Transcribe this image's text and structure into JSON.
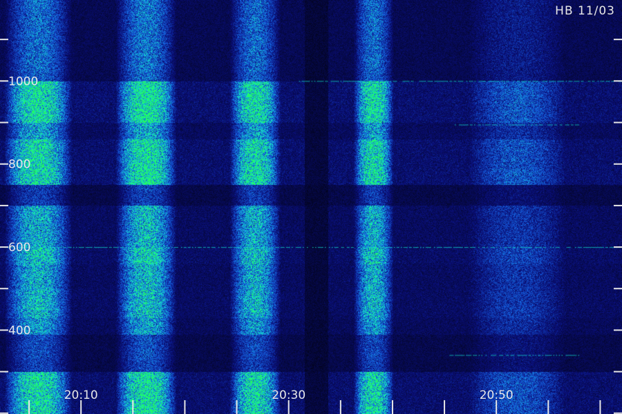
{
  "station_label": "HB 11/03",
  "colors": {
    "background": "#020319",
    "low": "#0a0f7a",
    "mid": "#1560e0",
    "high": "#13dccb",
    "peak": "#22ff5a",
    "labels": "#e8e8e8"
  },
  "chart_data": {
    "type": "heatmap",
    "title": "",
    "xlabel": "",
    "ylabel": "",
    "x_tick_labels": [
      "20:10",
      "20:30",
      "20:50"
    ],
    "x_tick_times_min": [
      10,
      30,
      50
    ],
    "x_range_min": [
      2.2,
      62.1
    ],
    "y_tick_labels": [
      "1000",
      "800",
      "600",
      "400"
    ],
    "y_tick_values": [
      1000,
      800,
      600,
      400
    ],
    "y_range": [
      198,
      1195
    ],
    "y_major_step": 100,
    "x_minor_step_min": 5,
    "echo_bursts": [
      {
        "start_min": 2.2,
        "end_min": 9.5,
        "intensity": 0.9
      },
      {
        "start_min": 13.0,
        "end_min": 19.5,
        "intensity": 0.95
      },
      {
        "start_min": 24.0,
        "end_min": 29.5,
        "intensity": 0.88
      },
      {
        "start_min": 36.0,
        "end_min": 40.3,
        "intensity": 0.9
      },
      {
        "start_min": 46.0,
        "end_min": 58.0,
        "intensity": 0.45
      }
    ],
    "quiet_gap_min": [
      31.5,
      33.8
    ],
    "frequency_bands": [
      {
        "low": 1000,
        "high": 1025,
        "gain": 0.25
      },
      {
        "low": 900,
        "high": 1000,
        "gain": 0.95
      },
      {
        "low": 860,
        "high": 900,
        "gain": 0.55
      },
      {
        "low": 790,
        "high": 860,
        "gain": 0.9
      },
      {
        "low": 750,
        "high": 790,
        "gain": 0.95
      },
      {
        "low": 700,
        "high": 750,
        "gain": 0.08
      },
      {
        "low": 600,
        "high": 700,
        "gain": 0.6
      },
      {
        "low": 560,
        "high": 600,
        "gain": 0.75
      },
      {
        "low": 500,
        "high": 560,
        "gain": 0.6
      },
      {
        "low": 430,
        "high": 500,
        "gain": 0.65
      },
      {
        "low": 390,
        "high": 430,
        "gain": 0.5
      },
      {
        "low": 330,
        "high": 390,
        "gain": 0.15
      },
      {
        "low": 300,
        "high": 330,
        "gain": 0.1
      },
      {
        "low": 198,
        "high": 300,
        "gain": 0.9
      }
    ],
    "carrier_lines": [
      {
        "freq": 1000,
        "start_min": 31.0,
        "end_min": 62.1
      },
      {
        "freq": 600,
        "start_min": 2.2,
        "end_min": 62.1
      },
      {
        "freq": 895,
        "start_min": 46.0,
        "end_min": 58.0
      },
      {
        "freq": 340,
        "start_min": 45.5,
        "end_min": 58.0
      }
    ]
  }
}
